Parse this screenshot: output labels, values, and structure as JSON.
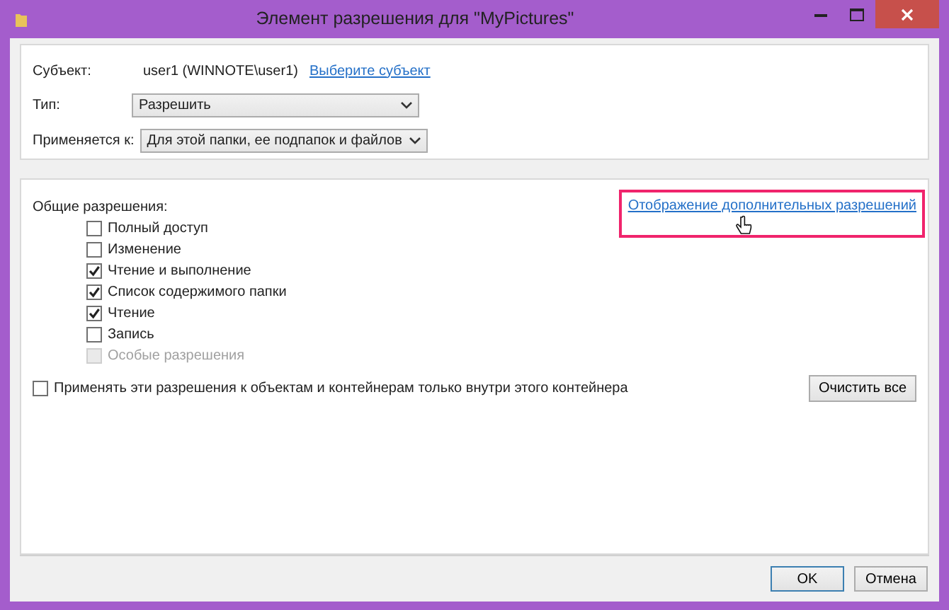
{
  "window": {
    "title": "Элемент разрешения для \"MyPictures\""
  },
  "principal": {
    "label": "Субъект:",
    "value": "user1 (WINNOTE\\user1)",
    "link": "Выберите субъект"
  },
  "fields": [
    {
      "label": "Тип:",
      "value": "Разрешить"
    },
    {
      "label": "Применяется к:",
      "value": "Для этой папки, ее подпапок и файлов"
    }
  ],
  "permissions": {
    "heading": "Общие разрешения:",
    "advanced_link": {
      "text": "Отображение дополнительных разрешений",
      "highlighted": true
    },
    "items": [
      {
        "label": "Полный доступ",
        "checked": false,
        "disabled": false
      },
      {
        "label": "Изменение",
        "checked": false,
        "disabled": false
      },
      {
        "label": "Чтение и выполнение",
        "checked": true,
        "disabled": false
      },
      {
        "label": "Список содержимого папки",
        "checked": true,
        "disabled": false
      },
      {
        "label": "Чтение",
        "checked": true,
        "disabled": false
      },
      {
        "label": "Запись",
        "checked": false,
        "disabled": false
      },
      {
        "label": "Особые разрешения",
        "checked": false,
        "disabled": true
      }
    ]
  },
  "apply_inside": {
    "label": "Применять эти разрешения к объектам и контейнерам только внутри этого контейнера",
    "checked": false
  },
  "clear_button": "Очистить все",
  "buttons": [
    {
      "label": "OK",
      "default": true
    },
    {
      "label": "Отмена",
      "default": false
    }
  ]
}
